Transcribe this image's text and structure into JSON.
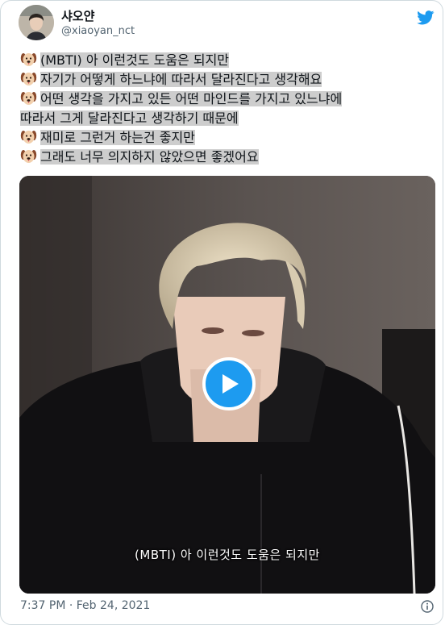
{
  "user": {
    "display_name": "샤오얀",
    "handle": "@xiaoyan_nct",
    "avatar_icon": "profile-photo"
  },
  "tweet": {
    "lines": [
      {
        "prefix_icon": "dog-emoji",
        "text": "(MBTI) 아 이런것도 도움은 되지만"
      },
      {
        "prefix_icon": "dog-emoji",
        "text": "자기가 어떻게 하느냐에 따라서 달라진다고 생각해요"
      },
      {
        "prefix_icon": "dog-emoji",
        "text": "어떤 생각을 가지고 있든 어떤 마인드를 가지고 있느냐에"
      },
      {
        "prefix_icon": "",
        "text": "따라서 그게 달라진다고 생각하기 때문에"
      },
      {
        "prefix_icon": "dog-emoji",
        "text": "재미로 그런거 하는건 좋지만"
      },
      {
        "prefix_icon": "dog-emoji",
        "text": "그래도 너무 의지하지 않았으면 좋겠어요"
      }
    ],
    "highlight_color": "#cdcdcd"
  },
  "media": {
    "subtitle": "(MBTI) 아 이런것도 도움은 되지만",
    "play_icon": "play-icon",
    "accent": "#1d9bf0"
  },
  "footer": {
    "timestamp": "7:37 PM · Feb 24, 2021",
    "info_icon": "info-icon"
  },
  "brand": {
    "icon": "twitter-bird-icon",
    "color": "#1d9bf0"
  }
}
